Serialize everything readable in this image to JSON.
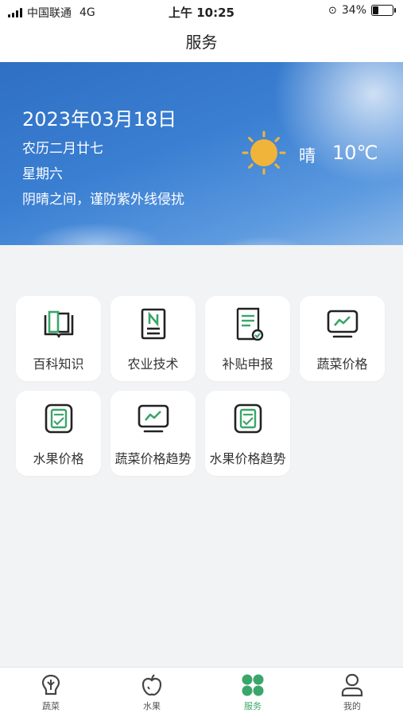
{
  "status_bar": {
    "carrier": "中国联通",
    "network": "4G",
    "time": "上午 10:25",
    "battery_percent": "34%",
    "battery_level": 0.34
  },
  "header": {
    "title": "服务"
  },
  "weather": {
    "date": "2023年03月18日",
    "lunar": "农历二月廿七",
    "weekday": "星期六",
    "tip": "阴晴之间，谨防紫外线侵扰",
    "condition": "晴",
    "temperature": "10℃",
    "icon": "sun-icon"
  },
  "services": [
    {
      "label": "百科知识",
      "icon": "book-icon"
    },
    {
      "label": "农业技术",
      "icon": "document-n-icon"
    },
    {
      "label": "补贴申报",
      "icon": "form-check-icon"
    },
    {
      "label": "蔬菜价格",
      "icon": "monitor-chart-icon"
    },
    {
      "label": "水果价格",
      "icon": "clipboard-check-icon"
    },
    {
      "label": "蔬菜价格趋势",
      "icon": "monitor-chart-icon"
    },
    {
      "label": "水果价格趋势",
      "icon": "clipboard-check-icon"
    }
  ],
  "tabs": [
    {
      "label": "蔬菜",
      "icon": "vegetable-icon"
    },
    {
      "label": "水果",
      "icon": "apple-icon"
    },
    {
      "label": "服务",
      "icon": "four-dots-icon"
    },
    {
      "label": "我的",
      "icon": "user-icon"
    }
  ],
  "active_tab": "服务",
  "colors": {
    "accent": "#3aa66a",
    "icon_dark": "#222222",
    "sun": "#f0b43a",
    "sky": "#3a7fd2"
  }
}
